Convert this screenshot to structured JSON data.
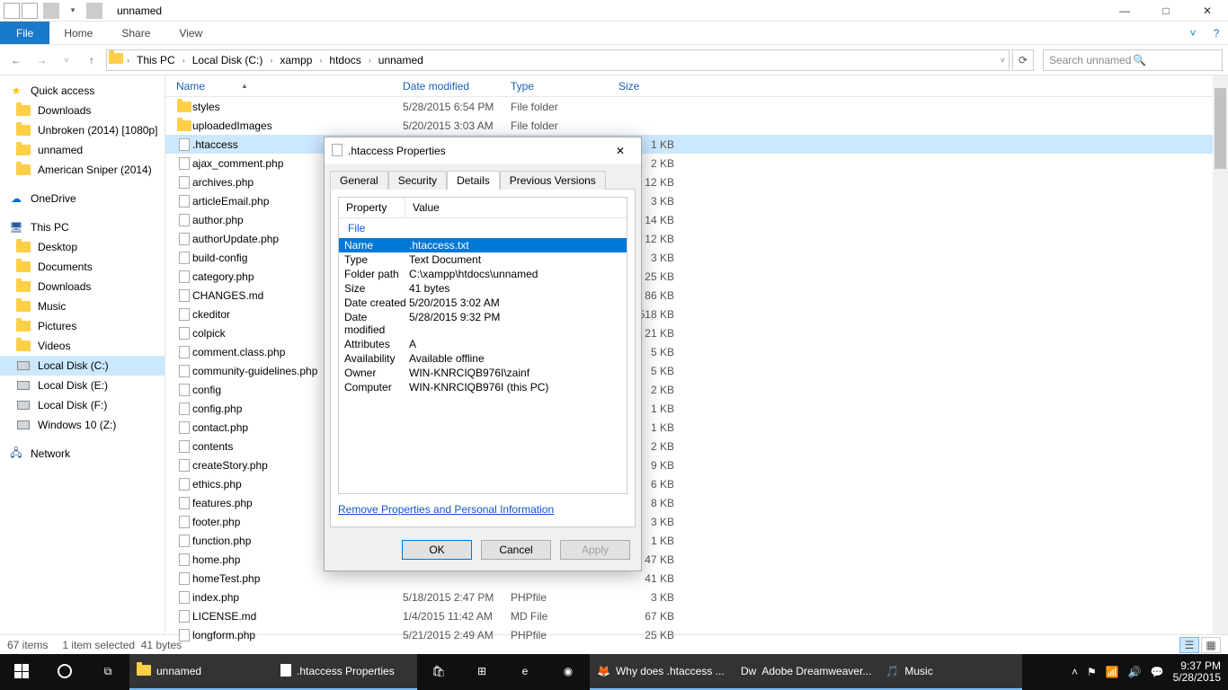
{
  "window": {
    "title": "unnamed"
  },
  "ribbon": {
    "file": "File",
    "tabs": [
      "Home",
      "Share",
      "View"
    ]
  },
  "breadcrumb": [
    "This PC",
    "Local Disk (C:)",
    "xampp",
    "htdocs",
    "unnamed"
  ],
  "search_placeholder": "Search unnamed",
  "sidebar": {
    "quick": {
      "label": "Quick access",
      "items": [
        "Downloads",
        "Unbroken (2014) [1080p]",
        "unnamed",
        "American Sniper (2014)"
      ]
    },
    "onedrive": "OneDrive",
    "thispc": {
      "label": "This PC",
      "items": [
        "Desktop",
        "Documents",
        "Downloads",
        "Music",
        "Pictures",
        "Videos",
        "Local Disk (C:)",
        "Local Disk (E:)",
        "Local Disk (F:)",
        "Windows 10 (Z:)"
      ],
      "selected": 6
    },
    "network": "Network"
  },
  "columns": [
    "Name",
    "Date modified",
    "Type",
    "Size"
  ],
  "files": [
    {
      "n": "styles",
      "d": "5/28/2015 6:54 PM",
      "t": "File folder",
      "s": "",
      "k": "folder"
    },
    {
      "n": "uploadedImages",
      "d": "5/20/2015 3:03 AM",
      "t": "File folder",
      "s": "",
      "k": "folder"
    },
    {
      "n": ".htaccess",
      "d": "",
      "t": "",
      "s": "1 KB",
      "k": "file",
      "sel": true
    },
    {
      "n": "ajax_comment.php",
      "d": "",
      "t": "",
      "s": "2 KB",
      "k": "php"
    },
    {
      "n": "archives.php",
      "d": "",
      "t": "",
      "s": "12 KB",
      "k": "php"
    },
    {
      "n": "articleEmail.php",
      "d": "",
      "t": "",
      "s": "3 KB",
      "k": "php"
    },
    {
      "n": "author.php",
      "d": "",
      "t": "",
      "s": "14 KB",
      "k": "php"
    },
    {
      "n": "authorUpdate.php",
      "d": "",
      "t": "",
      "s": "12 KB",
      "k": "php"
    },
    {
      "n": "build-config",
      "d": "",
      "t": "",
      "s": "3 KB",
      "k": "file"
    },
    {
      "n": "category.php",
      "d": "",
      "t": "",
      "s": "25 KB",
      "k": "php"
    },
    {
      "n": "CHANGES.md",
      "d": "",
      "t": "",
      "s": "86 KB",
      "k": "file"
    },
    {
      "n": "ckeditor",
      "d": "",
      "t": "",
      "s": "518 KB",
      "k": "file"
    },
    {
      "n": "colpick",
      "d": "",
      "t": "",
      "s": "21 KB",
      "k": "file"
    },
    {
      "n": "comment.class.php",
      "d": "",
      "t": "",
      "s": "5 KB",
      "k": "php"
    },
    {
      "n": "community-guidelines.php",
      "d": "",
      "t": "",
      "s": "5 KB",
      "k": "php"
    },
    {
      "n": "config",
      "d": "",
      "t": "",
      "s": "2 KB",
      "k": "file"
    },
    {
      "n": "config.php",
      "d": "",
      "t": "",
      "s": "1 KB",
      "k": "php"
    },
    {
      "n": "contact.php",
      "d": "",
      "t": "",
      "s": "1 KB",
      "k": "php"
    },
    {
      "n": "contents",
      "d": "",
      "t": "",
      "s": "2 KB",
      "k": "file"
    },
    {
      "n": "createStory.php",
      "d": "",
      "t": "",
      "s": "9 KB",
      "k": "php"
    },
    {
      "n": "ethics.php",
      "d": "",
      "t": "",
      "s": "6 KB",
      "k": "php"
    },
    {
      "n": "features.php",
      "d": "",
      "t": "",
      "s": "8 KB",
      "k": "php"
    },
    {
      "n": "footer.php",
      "d": "",
      "t": "",
      "s": "3 KB",
      "k": "php"
    },
    {
      "n": "function.php",
      "d": "",
      "t": "",
      "s": "1 KB",
      "k": "php"
    },
    {
      "n": "home.php",
      "d": "",
      "t": "",
      "s": "47 KB",
      "k": "php"
    },
    {
      "n": "homeTest.php",
      "d": "",
      "t": "",
      "s": "41 KB",
      "k": "php"
    },
    {
      "n": "index.php",
      "d": "5/18/2015 2:47 PM",
      "t": "PHPfile",
      "s": "3 KB",
      "k": "php"
    },
    {
      "n": "LICENSE.md",
      "d": "1/4/2015 11:42 AM",
      "t": "MD File",
      "s": "67 KB",
      "k": "file"
    },
    {
      "n": "longform.php",
      "d": "5/21/2015 2:49 AM",
      "t": "PHPfile",
      "s": "25 KB",
      "k": "php"
    }
  ],
  "status": {
    "count": "67 items",
    "sel": "1 item selected",
    "size": "41 bytes"
  },
  "dialog": {
    "title": ".htaccess Properties",
    "tabs": [
      "General",
      "Security",
      "Details",
      "Previous Versions"
    ],
    "active_tab": 2,
    "header": [
      "Property",
      "Value"
    ],
    "group": "File",
    "rows": [
      {
        "p": "Name",
        "v": ".htaccess.txt",
        "sel": true
      },
      {
        "p": "Type",
        "v": "Text Document"
      },
      {
        "p": "Folder path",
        "v": "C:\\xampp\\htdocs\\unnamed"
      },
      {
        "p": "Size",
        "v": "41 bytes"
      },
      {
        "p": "Date created",
        "v": "5/20/2015 3:02 AM"
      },
      {
        "p": "Date modified",
        "v": "5/28/2015 9:32 PM"
      },
      {
        "p": "Attributes",
        "v": "A"
      },
      {
        "p": "Availability",
        "v": "Available offline"
      },
      {
        "p": "Owner",
        "v": "WIN-KNRCIQB976I\\zainf"
      },
      {
        "p": "Computer",
        "v": "WIN-KNRCIQB976I (this PC)"
      }
    ],
    "remove": "Remove Properties and Personal Information",
    "buttons": {
      "ok": "OK",
      "cancel": "Cancel",
      "apply": "Apply"
    }
  },
  "taskbar": {
    "items": [
      {
        "label": "unnamed",
        "ico": "folder",
        "active": true
      },
      {
        "label": ".htaccess Properties",
        "ico": "file",
        "active": true
      },
      {
        "label": "",
        "ico": "store"
      },
      {
        "label": "",
        "ico": "store2"
      },
      {
        "label": "",
        "ico": "edge"
      },
      {
        "label": "",
        "ico": "chrome"
      },
      {
        "label": "Why does .htaccess ...",
        "ico": "ff",
        "active": true
      },
      {
        "label": "Adobe Dreamweaver...",
        "ico": "dw",
        "active": true
      },
      {
        "label": "Music",
        "ico": "music",
        "active": true
      }
    ],
    "time": "9:37 PM",
    "date": "5/28/2015"
  }
}
